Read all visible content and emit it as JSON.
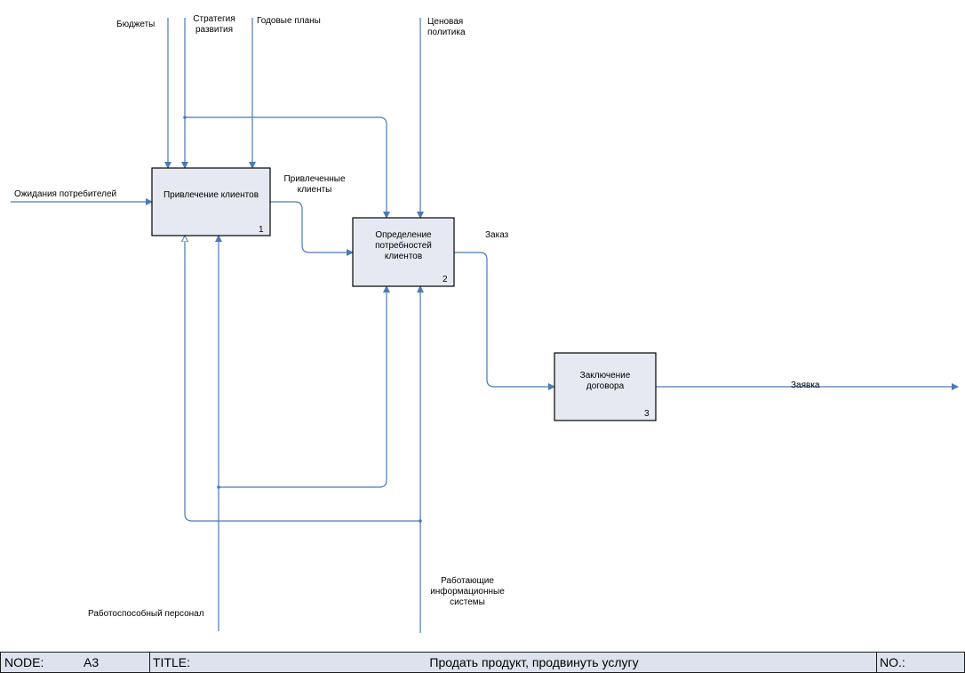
{
  "boxes": [
    {
      "id": "1",
      "label": "Привлечение клиентов",
      "number": "1"
    },
    {
      "id": "2",
      "label": "Определение\nпотребностей\nклиентов",
      "number": "2"
    },
    {
      "id": "3",
      "label": "Заключение\nдоговора",
      "number": "3"
    }
  ],
  "arrows": {
    "budgets": "Бюджеты",
    "strategy": "Стратегия\nразвития",
    "annual_plans": "Годовые планы",
    "price_policy": "Ценовая\nполитика",
    "customer_expectations": "Ожидания потребителей",
    "attracted_clients": "Привлеченные\nклиенты",
    "order": "Заказ",
    "application": "Заявка",
    "staff": "Работоспособный персонал",
    "info_systems": "Работающие\nинформационные\nсистемы"
  },
  "colors": {
    "line": "#4a7ab5",
    "box_fill": "#e6e9f2",
    "box_border": "#000000",
    "footer_bg": "#dde3ee"
  },
  "footer": {
    "node_label": "NODE:",
    "node_value": "A3",
    "title_label": "TITLE:",
    "title_value": "Продать продукт, продвинуть услугу",
    "no_label": "NO.:"
  }
}
